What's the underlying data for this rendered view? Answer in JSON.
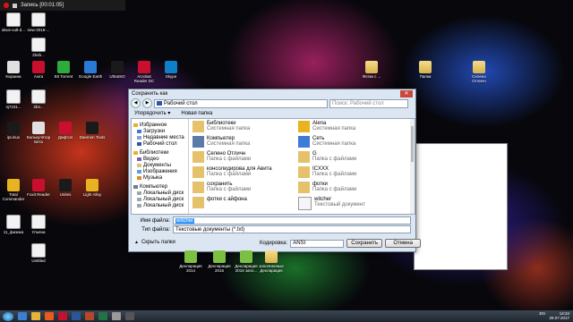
{
  "recorder": {
    "title": "Запись [00:01:05]"
  },
  "desktop_icons_left": [
    {
      "label": "deus-vult-d...",
      "kind": "doc"
    },
    {
      "label": "new-2016-...",
      "kind": "doc"
    },
    {
      "label": "2b4b...",
      "kind": "doc"
    },
    {
      "label": "Корзина",
      "kind": "app4"
    },
    {
      "label": "Avira",
      "kind": "app1"
    },
    {
      "label": "Bit Torrent",
      "kind": "app5"
    },
    {
      "label": "Google Earth",
      "kind": "app2"
    },
    {
      "label": "UltraISO",
      "kind": "app3"
    },
    {
      "label": "Acrobat Reader DC",
      "kind": "app1"
    },
    {
      "label": "Skype",
      "kind": "app8"
    },
    {
      "label": "4j7231...",
      "kind": "doc"
    },
    {
      "label": "2b4...",
      "kind": "doc"
    },
    {
      "label": "ipLinux",
      "kind": "app3"
    },
    {
      "label": "Калькулятор Бета",
      "kind": "app4"
    },
    {
      "label": "Дифтол",
      "kind": "app1"
    },
    {
      "label": "Daemon Tools",
      "kind": "app3"
    },
    {
      "label": "Total Commander",
      "kind": "app6"
    },
    {
      "label": "Foxit Reader",
      "kind": "app1"
    },
    {
      "label": "Unites",
      "kind": "app3"
    },
    {
      "label": "Light Alloy",
      "kind": "app6"
    },
    {
      "label": "11_физика",
      "kind": "doc"
    },
    {
      "label": "Ульяна",
      "kind": "doc"
    },
    {
      "label": "Untitled",
      "kind": "doc"
    }
  ],
  "desktop_icons_right": [
    {
      "label": "Фотки с ...",
      "kind": "folder"
    },
    {
      "label": "Папки",
      "kind": "folder"
    },
    {
      "label": "Селено Отличн",
      "kind": "folder"
    }
  ],
  "desktop_icons_bottom": [
    {
      "label": "Декларация 2014",
      "kind": "app7"
    },
    {
      "label": "Декларация 2015",
      "kind": "app7"
    },
    {
      "label": "Декларация 2016 запо...",
      "kind": "app7"
    },
    {
      "label": "заполненные Декларация",
      "kind": "folder"
    }
  ],
  "dialog": {
    "title": "Сохранить как",
    "address": "Рабочий стол",
    "search_placeholder": "Поиск: Рабочий стол",
    "toolbar": {
      "organize": "Упорядочить ▾",
      "new_folder": "Новая папка"
    },
    "nav": [
      {
        "label": "Избранное",
        "head": true,
        "color": "#e6b422"
      },
      {
        "label": "Загрузки",
        "head": false,
        "color": "#3d7bd9"
      },
      {
        "label": "Недавние места",
        "head": false,
        "color": "#8aa2c8"
      },
      {
        "label": "Рабочий стол",
        "head": false,
        "color": "#2c5aa0"
      },
      {
        "label": "Библиотеки",
        "head": true,
        "color": "#e6b422"
      },
      {
        "label": "Видео",
        "head": false,
        "color": "#7b5fb0"
      },
      {
        "label": "Документы",
        "head": false,
        "color": "#d9c27a"
      },
      {
        "label": "Изображения",
        "head": false,
        "color": "#5fa0d9"
      },
      {
        "label": "Музыка",
        "head": false,
        "color": "#e08a2a"
      },
      {
        "label": "Компьютер",
        "head": true,
        "color": "#6b7c93"
      },
      {
        "label": "Локальный диск",
        "head": false,
        "color": "#9aa"
      },
      {
        "label": "Локальный диск",
        "head": false,
        "color": "#9aa"
      },
      {
        "label": "Локальный диск",
        "head": false,
        "color": "#9aa"
      }
    ],
    "files": [
      {
        "name": "Библиотеки",
        "sub": "Системная папка",
        "icon": "library"
      },
      {
        "name": "Alena",
        "sub": "Системная папка",
        "icon": "user"
      },
      {
        "name": "Компьютер",
        "sub": "Системная папка",
        "icon": "computer"
      },
      {
        "name": "Сеть",
        "sub": "Системная папка",
        "icon": "network"
      },
      {
        "name": "Селено Отличн",
        "sub": "Папка с файлами",
        "icon": "folder"
      },
      {
        "name": "G",
        "sub": "Папка с файлами",
        "icon": "folder"
      },
      {
        "name": "консолидирова для Авита",
        "sub": "Папка с файлами",
        "icon": "folder"
      },
      {
        "name": "ICXXX",
        "sub": "Папка с файлами",
        "icon": "folder"
      },
      {
        "name": "сохранить",
        "sub": "Папка с файлами",
        "icon": "folder"
      },
      {
        "name": "фотки",
        "sub": "Папка с файлами",
        "icon": "folder"
      },
      {
        "name": "фотки с айфона",
        "sub": "",
        "icon": "folder"
      },
      {
        "name": "witcher",
        "sub": "Текстовый документ",
        "icon": "doc"
      }
    ],
    "filename_label": "Имя файла:",
    "filename_value": "witcher",
    "type_label": "Тип файла:",
    "type_value": "Текстовые документы (*.txt)",
    "hide_folders": "Скрыть папки",
    "encoding_label": "Кодировка:",
    "encoding_value": "ANSI",
    "save": "Сохранить",
    "cancel": "Отмена"
  },
  "taskbar": {
    "language": "EN",
    "time": "14:34",
    "date": "29.07.2017"
  }
}
